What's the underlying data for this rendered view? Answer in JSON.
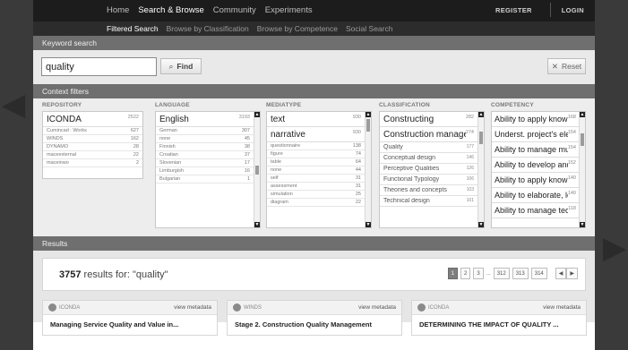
{
  "topnav": {
    "items": [
      "Home",
      "Search & Browse",
      "Community",
      "Experiments"
    ],
    "register": "REGISTER",
    "login": "LOGIN"
  },
  "subnav": {
    "items": [
      "Filtered Search",
      "Browse by Classification",
      "Browse by Competence",
      "Social Search"
    ]
  },
  "keyword": {
    "section_title": "Keyword search",
    "query": "quality",
    "find_label": "Find",
    "reset_label": "Reset",
    "find_icon": "search-icon",
    "reset_icon": "close-icon"
  },
  "filters": {
    "section_title": "Context filters",
    "repository": {
      "header": "REPOSITORY",
      "selected": {
        "label": "ICONDA",
        "count": "2522"
      },
      "items": [
        {
          "label": "Cumincad : Works",
          "count": "627"
        },
        {
          "label": "WINDS",
          "count": "162"
        },
        {
          "label": "DYNAMO",
          "count": "28"
        },
        {
          "label": "maceexternal",
          "count": "22"
        },
        {
          "label": "maceinwo",
          "count": "2"
        }
      ]
    },
    "language": {
      "header": "LANGUAGE",
      "selected": {
        "label": "English",
        "count": "3193"
      },
      "items": [
        {
          "label": "German",
          "count": "307"
        },
        {
          "label": "none",
          "count": "45"
        },
        {
          "label": "Finnish",
          "count": "38"
        },
        {
          "label": "Croatian",
          "count": "37"
        },
        {
          "label": "Slovenian",
          "count": "17"
        },
        {
          "label": "Limburgish",
          "count": "16"
        },
        {
          "label": "Bulgarian",
          "count": "1"
        }
      ]
    },
    "mediatype": {
      "header": "MEDIATYPE",
      "selected": [
        {
          "label": "text",
          "count": "930"
        },
        {
          "label": "narrative",
          "count": "930"
        }
      ],
      "items": [
        {
          "label": "questionnaire",
          "count": "138"
        },
        {
          "label": "figure",
          "count": "74"
        },
        {
          "label": "table",
          "count": "64"
        },
        {
          "label": "none",
          "count": "44"
        },
        {
          "label": "self",
          "count": "31"
        },
        {
          "label": "assessment",
          "count": "31"
        },
        {
          "label": "simulation",
          "count": "25"
        },
        {
          "label": "diagram",
          "count": "22"
        }
      ]
    },
    "classification": {
      "header": "CLASSIFICATION",
      "selected": [
        {
          "label": "Constructing",
          "count": "282"
        },
        {
          "label": "Construction management",
          "count": "274"
        }
      ],
      "items": [
        {
          "label": "Quality",
          "count": "177"
        },
        {
          "label": "Conceptual design",
          "count": "146"
        },
        {
          "label": "Perceptive Qualities",
          "count": "126"
        },
        {
          "label": "Functional Typology",
          "count": "106"
        },
        {
          "label": "Theories and concepts",
          "count": "103"
        },
        {
          "label": "Technical design",
          "count": "101"
        }
      ]
    },
    "competency": {
      "header": "COMPETENCY",
      "items": [
        {
          "label": "Ability to apply knowledge",
          "count": "168"
        },
        {
          "label": "Underst. project's elements",
          "count": "154"
        },
        {
          "label": "Ability to manage multiple",
          "count": "154"
        },
        {
          "label": "Ability to develop and",
          "count": "152"
        },
        {
          "label": "Ability to apply knowledge",
          "count": "140"
        },
        {
          "label": "Ability to elaborate, lead",
          "count": "140"
        },
        {
          "label": "Ability to manage technical",
          "count": "118"
        }
      ]
    }
  },
  "results": {
    "section_title": "Results",
    "count": "3757",
    "label": "results for: \"quality\"",
    "pages": [
      "1",
      "2",
      "3"
    ],
    "ellipsis": "...",
    "last_pages": [
      "312",
      "313",
      "314"
    ],
    "prev": "◀",
    "next": "▶",
    "cards": [
      {
        "source": "ICONDA",
        "meta": "view metadata",
        "title": "Managing Service Quality and Value in..."
      },
      {
        "source": "WINDS",
        "meta": "view metadata",
        "title": "Stage 2. Construction Quality Management"
      },
      {
        "source": "ICONDA",
        "meta": "view metadata",
        "title": "DETERMINING THE IMPACT OF QUALITY ..."
      }
    ]
  },
  "colors": {
    "topbar": "#1c1c1c",
    "subbar": "#2c2c2c",
    "section_bar": "#6f6f6f",
    "background": "#3a3a3a"
  }
}
